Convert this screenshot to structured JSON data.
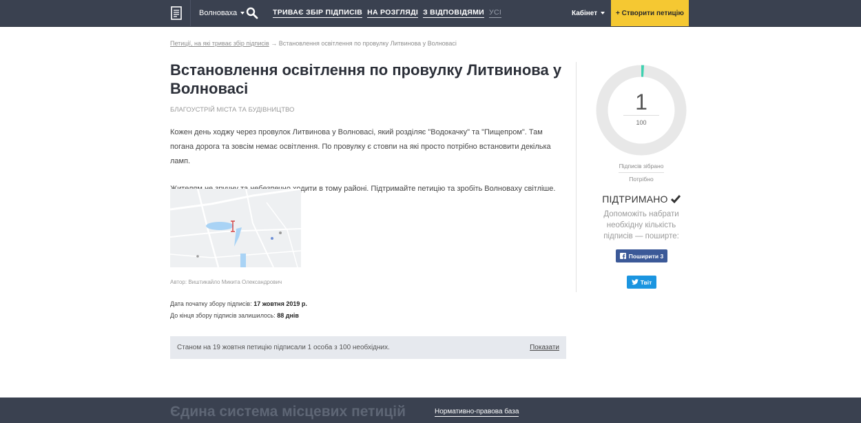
{
  "header": {
    "city": "Волноваха",
    "nav": [
      {
        "label": "Триває збір підписів"
      },
      {
        "label": "На розгляді"
      },
      {
        "label": "З відповідями"
      },
      {
        "label": "Усі"
      }
    ],
    "cabinet": "Кабінет",
    "create": "+ Створити петицію"
  },
  "breadcrumb": {
    "parent": "Петиції, на які триває збір підписів",
    "separator": "→",
    "current": "Встановлення освітлення по провулку Литвинова у Волновасі"
  },
  "petition": {
    "title": "Встановлення освітлення по провулку Литвинова у Волновасі",
    "category": "Благоустрій міста та будівництво",
    "paragraphs": [
      "Кожен день ходжу через провулок Литвинова у Волновасі, який розділяє \"Водокачку\" та \"Пищепром\". Там погана дорога та зовсім немає освітлення. По провулку є стовпи на які просто потрібно встановити декілька ламп.",
      "Жителям не зручну та небезпечно ходити в тому районі. Підтримайте петицію та зробіть Волноваху світліше."
    ],
    "author": "Автор: Виштикайло Микита Олександрович",
    "start_label": "Дата початку збору підписів:",
    "start_value": "17 жовтня 2019 р.",
    "left_label": "До кінця збору підписів залишилось:",
    "left_value": "88 днів",
    "status_text": "Станом на 19 жовтня петицію підписали 1 особа з 100 необхідних.",
    "show_link": "Показати"
  },
  "sidebar": {
    "signatures": "1",
    "needed": "100",
    "progress_fraction": 0.01,
    "collected_label": "Підписів зібрано",
    "needed_label": "Потрібно",
    "supported": "ПІДТРИМАНО",
    "help_text": "Допоможіть набрати необхідну кількість підписів — поширте:",
    "fb_label": "Поширити 3",
    "tw_label": "Твіт"
  },
  "footer": {
    "title": "Єдина система місцевих петицій",
    "link": "Нормативно-правова база"
  },
  "colors": {
    "nav_bg": "#3a4150",
    "accent_yellow": "#f5c832",
    "progress_fill": "#3fd1b0",
    "progress_track": "#e8e8e8",
    "facebook": "#3b5998",
    "twitter": "#1b95e0"
  }
}
